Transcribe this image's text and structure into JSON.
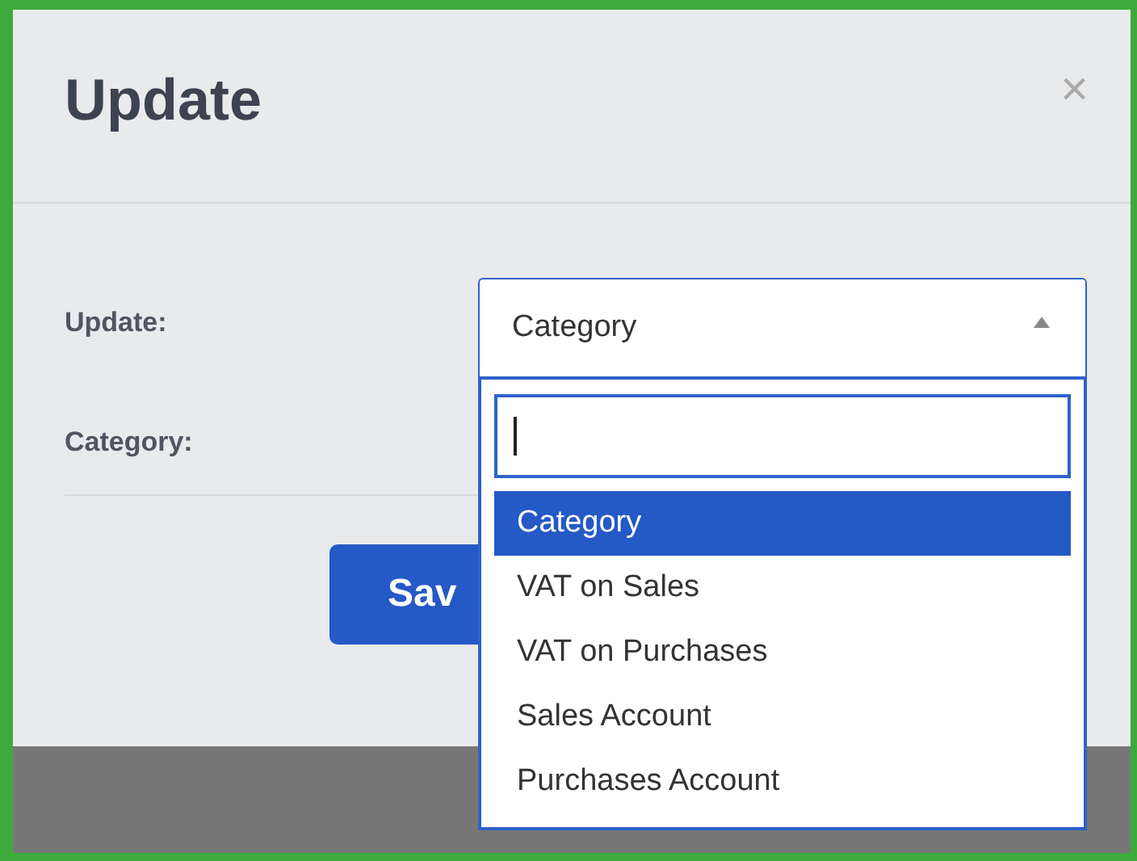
{
  "dialog": {
    "title": "Update",
    "close": "×"
  },
  "fields": [
    {
      "label": "Update:",
      "kind": "select",
      "value": "Category",
      "expanded": true
    },
    {
      "label": "Category:",
      "kind": "empty"
    }
  ],
  "dropdown_options": [
    {
      "label": "Category",
      "selected": true
    },
    {
      "label": "VAT on Sales",
      "selected": false
    },
    {
      "label": "VAT on Purchases",
      "selected": false
    },
    {
      "label": "Sales Account",
      "selected": false
    },
    {
      "label": "Purchases Account",
      "selected": false
    }
  ],
  "save_button": "Sav"
}
